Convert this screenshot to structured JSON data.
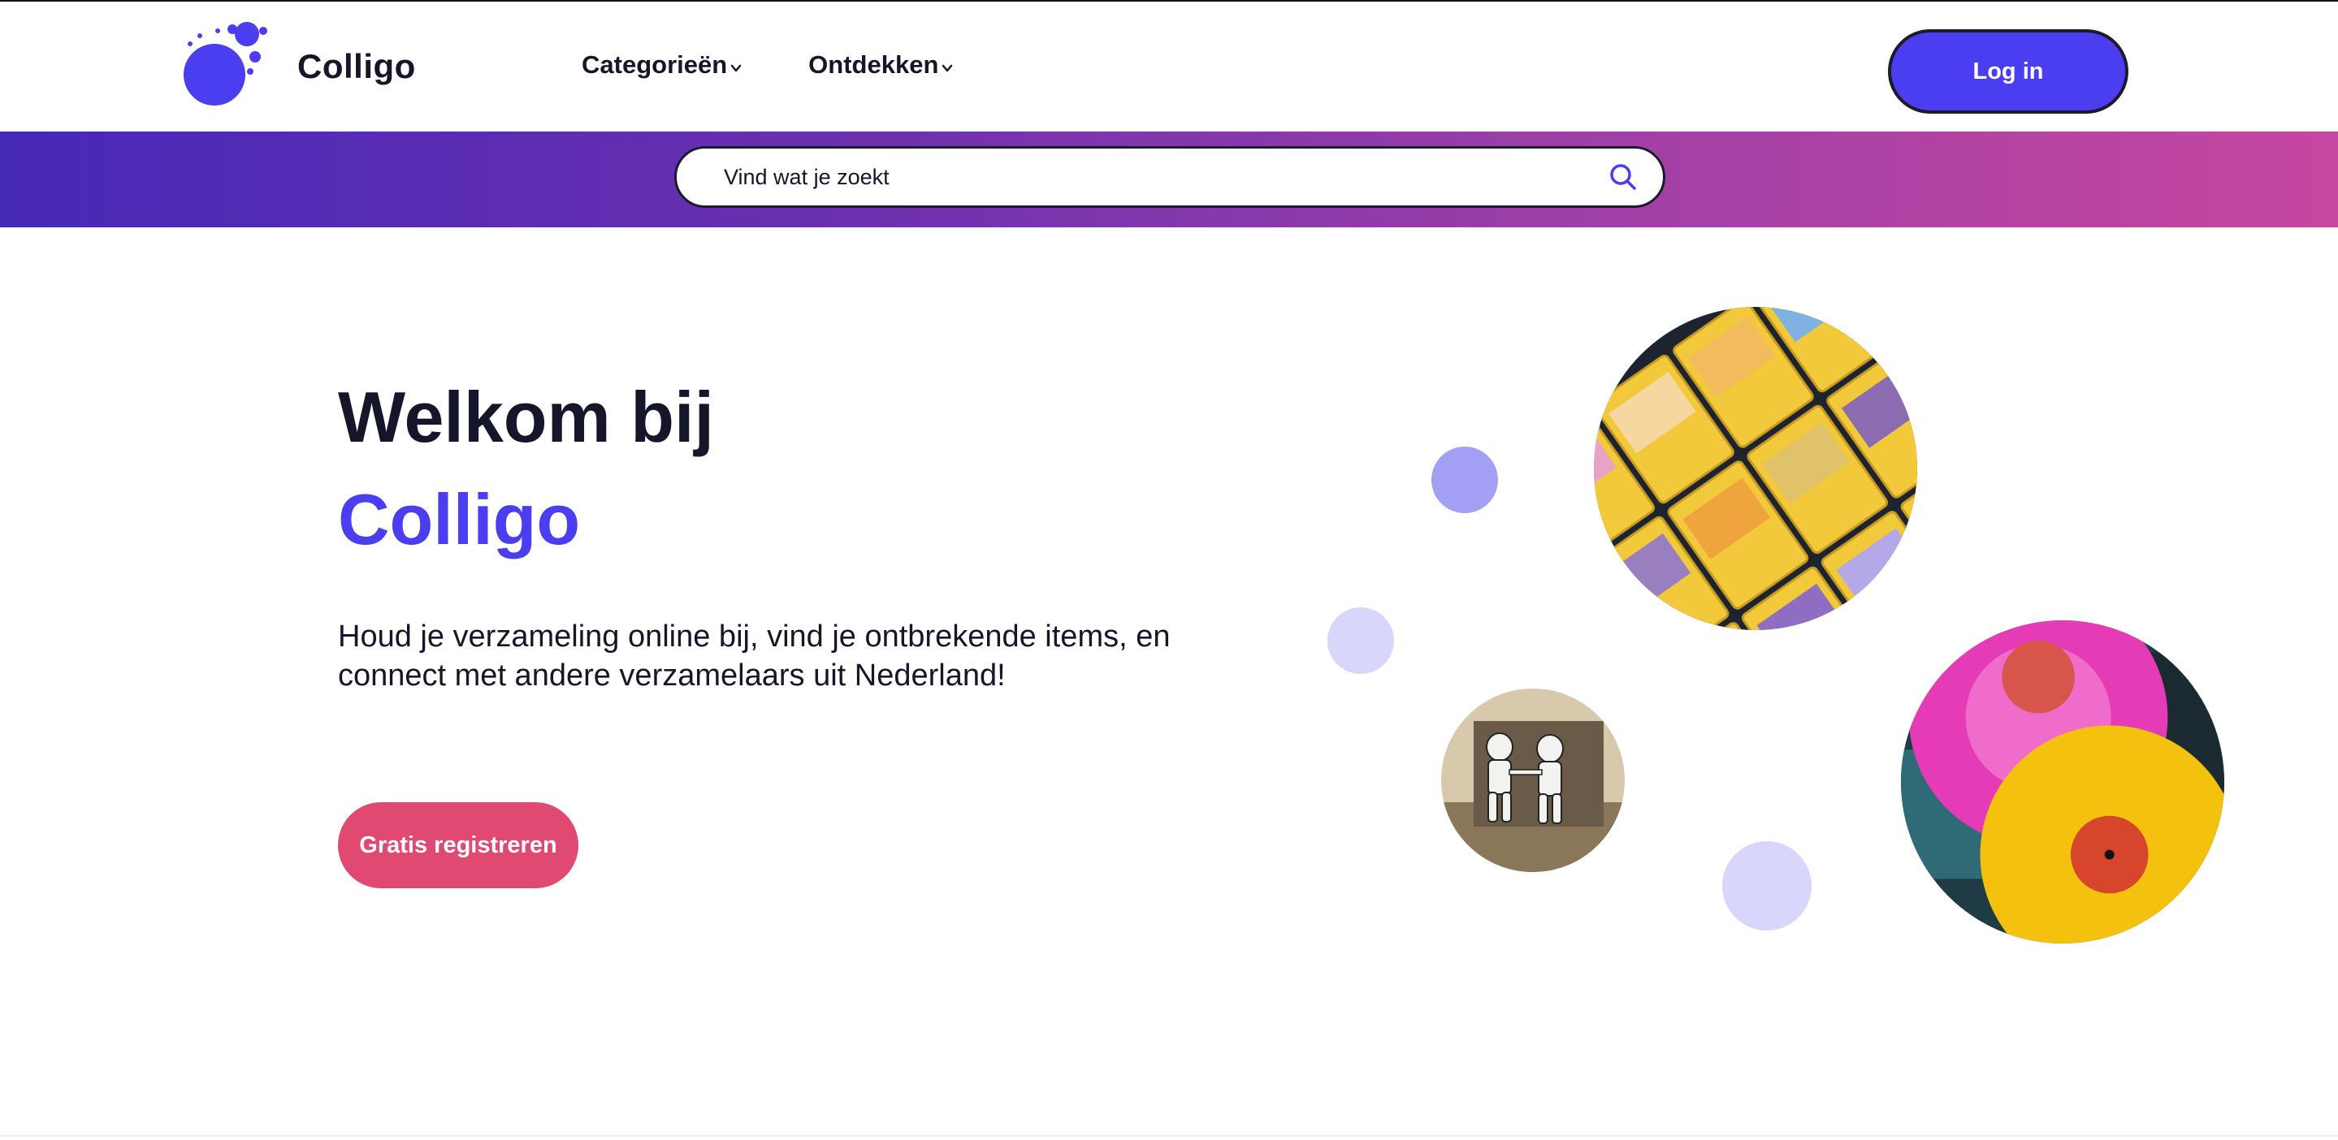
{
  "header": {
    "brand": "Colligo",
    "nav": [
      {
        "label": "Categorieën",
        "icon": "chevron-down-icon"
      },
      {
        "label": "Ontdekken",
        "icon": "chevron-down-icon"
      }
    ],
    "login_label": "Log in"
  },
  "search": {
    "placeholder": "Vind wat je zoekt",
    "icon": "search-icon"
  },
  "hero": {
    "title_line1": "Welkom bij",
    "title_line2": "Colligo",
    "description": "Houd je verzameling online bij, vind je ontbrekende items, en connect met andere verzamelaars uit Nederland!",
    "cta_label": "Gratis registreren"
  },
  "colors": {
    "brand": "#4b3df0",
    "cta": "#e04a72",
    "text": "#16162a",
    "gradient_start": "#4629b6",
    "gradient_end": "#c6479f"
  }
}
